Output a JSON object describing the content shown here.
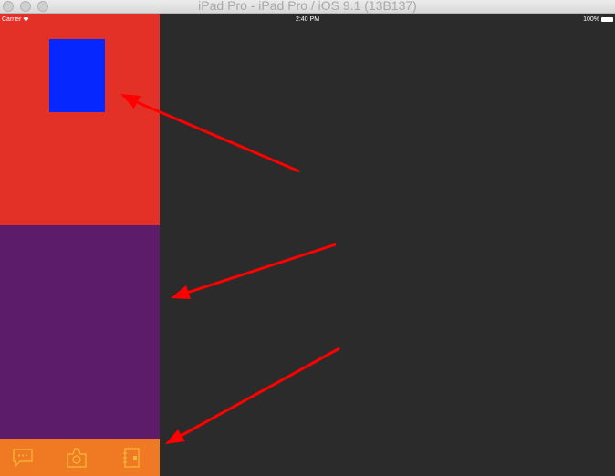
{
  "window": {
    "title": "iPad Pro - iPad Pro / iOS 9.1 (13B137)"
  },
  "status_bar": {
    "carrier": "Carrier",
    "time": "2:40 PM",
    "battery": "100%"
  },
  "colors": {
    "top_panel": "#e43128",
    "blue_box": "#0727ff",
    "middle_panel": "#5d1c69",
    "tab_bar": "#f07a23",
    "tab_icon": "#f6b83a",
    "background": "#2b2b2b",
    "arrow": "#ff0000"
  },
  "tab_bar": {
    "items": [
      {
        "icon": "chat-bubble-icon"
      },
      {
        "icon": "camera-icon"
      },
      {
        "icon": "contacts-book-icon"
      }
    ]
  },
  "annotations": [
    {
      "icon": "red-arrow",
      "target": "blue-box"
    },
    {
      "icon": "red-arrow",
      "target": "middle-panel"
    },
    {
      "icon": "red-arrow",
      "target": "tab-bar"
    }
  ]
}
